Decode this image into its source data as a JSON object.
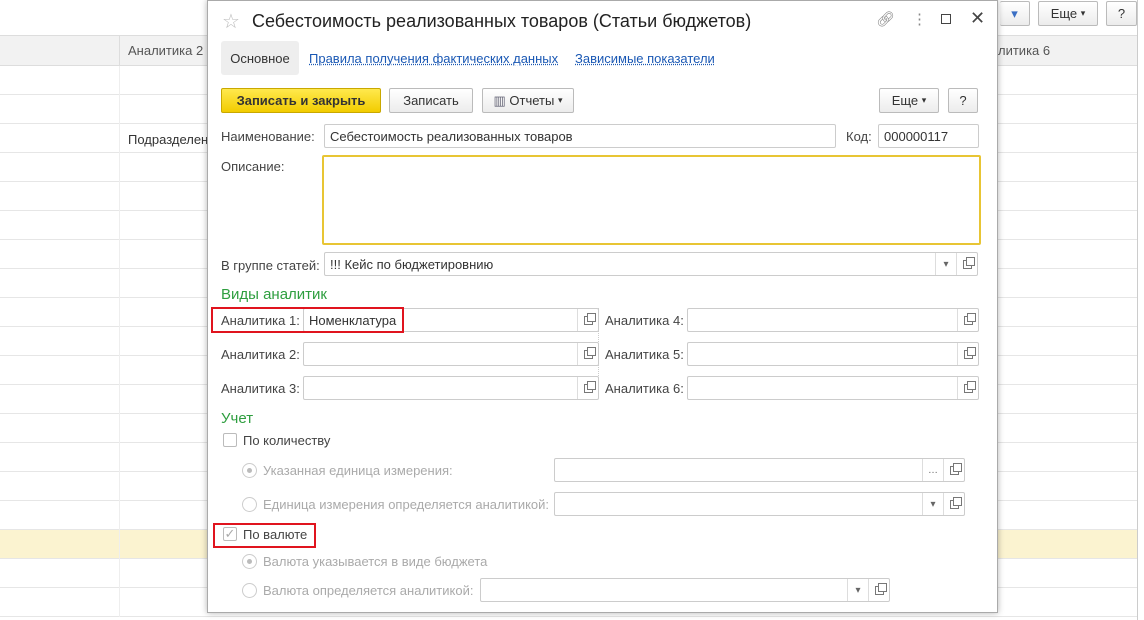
{
  "background": {
    "columns": [
      "Аналитика 2",
      "литика 6"
    ],
    "row_text": "Подразделен",
    "more_label": "Еще",
    "help_label": "?"
  },
  "dialog": {
    "title": "Себестоимость реализованных товаров (Статьи бюджетов)",
    "tabs": [
      "Основное",
      "Правила получения фактических данных",
      "Зависимые показатели"
    ],
    "toolbar": {
      "save_close": "Записать и закрыть",
      "save": "Записать",
      "reports": "Отчеты",
      "more": "Еще",
      "help": "?"
    },
    "name_label": "Наименование:",
    "name_value": "Себестоимость реализованных товаров",
    "code_label": "Код:",
    "code_value": "000000117",
    "description_label": "Описание:",
    "description_value": "",
    "group_label": "В группе статей:",
    "group_value": "!!! Кейс по бюджетировнию",
    "analytics_title": "Виды аналитик",
    "analytics": [
      {
        "label": "Аналитика 1:",
        "value": "Номенклатура"
      },
      {
        "label": "Аналитика 2:",
        "value": ""
      },
      {
        "label": "Аналитика 3:",
        "value": ""
      },
      {
        "label": "Аналитика 4:",
        "value": ""
      },
      {
        "label": "Аналитика 5:",
        "value": ""
      },
      {
        "label": "Аналитика 6:",
        "value": ""
      }
    ],
    "accounting_title": "Учет",
    "by_quantity": {
      "label": "По количеству",
      "checked": false
    },
    "unit_specified": "Указанная единица измерения:",
    "unit_by_analytics": "Единица измерения определяется аналитикой:",
    "by_currency": {
      "label": "По валюте",
      "checked": true
    },
    "currency_in_budget": "Валюта указывается в виде бюджета",
    "currency_by_analytics": "Валюта определяется аналитикой:"
  }
}
